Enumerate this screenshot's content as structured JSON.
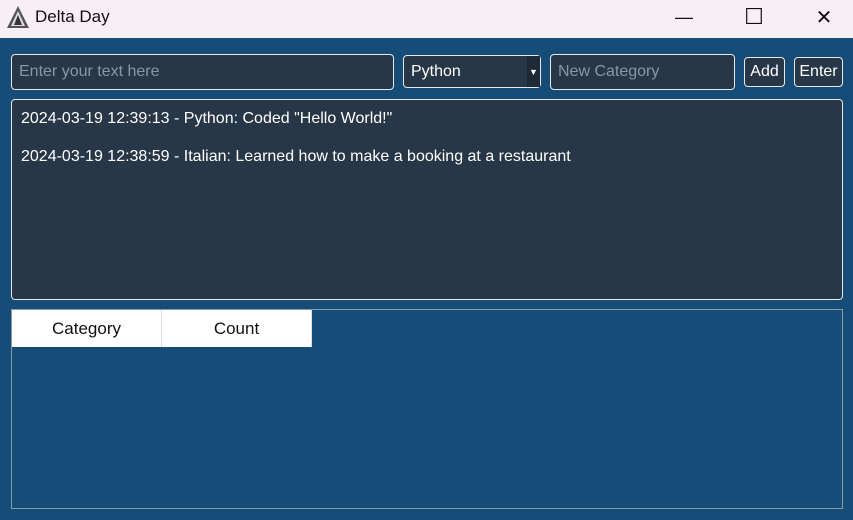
{
  "window": {
    "title": "Delta Day",
    "minimize": "—",
    "maximize": "☐",
    "close": "✕"
  },
  "toolbar": {
    "text_placeholder": "Enter your text here",
    "category_selected": "Python",
    "new_category_placeholder": "New Category",
    "add_label": "Add",
    "enter_label": "Enter"
  },
  "log": {
    "entries": [
      "2024-03-19 12:39:13 - Python: Coded \"Hello World!\"",
      "2024-03-19 12:38:59 - Italian: Learned how to make a booking at a restaurant"
    ]
  },
  "table": {
    "columns": [
      "Category",
      "Count"
    ],
    "rows": []
  }
}
